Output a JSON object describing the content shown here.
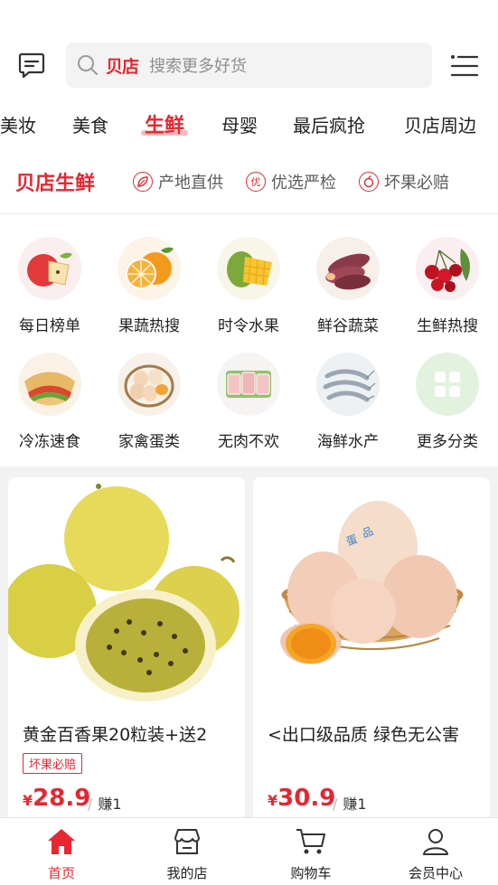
{
  "header": {
    "search_brand": "贝店",
    "search_placeholder": "搜索更多好货"
  },
  "tabs": [
    {
      "label": "美妆"
    },
    {
      "label": "美食"
    },
    {
      "label": "生鲜",
      "active": true
    },
    {
      "label": "母婴"
    },
    {
      "label": "最后疯抢"
    },
    {
      "label": "贝店周边"
    }
  ],
  "section": {
    "title": "贝店生鲜",
    "features": [
      {
        "label": "产地直供",
        "icon": "leaf-icon"
      },
      {
        "label": "优选严检",
        "icon": "quality-icon"
      },
      {
        "label": "坏果必赔",
        "icon": "fruit-icon"
      }
    ]
  },
  "categories": [
    {
      "label": "每日榜单",
      "icon": "apple-icon"
    },
    {
      "label": "果蔬热搜",
      "icon": "orange-icon"
    },
    {
      "label": "时令水果",
      "icon": "mango-icon"
    },
    {
      "label": "鲜谷蔬菜",
      "icon": "sweet-potato-icon"
    },
    {
      "label": "生鲜热搜",
      "icon": "cherry-icon"
    },
    {
      "label": "冷冻速食",
      "icon": "pancake-icon"
    },
    {
      "label": "家禽蛋类",
      "icon": "egg-basket-icon"
    },
    {
      "label": "无肉不欢",
      "icon": "meat-icon"
    },
    {
      "label": "海鲜水产",
      "icon": "shrimp-icon"
    },
    {
      "label": "更多分类",
      "icon": "grid-icon"
    }
  ],
  "products": [
    {
      "name": "黄金百香果20粒装+送2",
      "badge": "坏果必赔",
      "price_symbol": "¥",
      "price": "28.9",
      "earn": "赚1",
      "image": "passion-fruit-image"
    },
    {
      "name": "<出口级品质 绿色无公害",
      "badge": "",
      "price_symbol": "¥",
      "price": "30.9",
      "earn": "赚1",
      "image": "eggs-basket-image"
    }
  ],
  "bottom_nav": [
    {
      "label": "首页",
      "icon": "home-icon",
      "active": true
    },
    {
      "label": "我的店",
      "icon": "shop-icon"
    },
    {
      "label": "购物车",
      "icon": "cart-icon"
    },
    {
      "label": "会员中心",
      "icon": "user-icon"
    }
  ],
  "colors": {
    "accent": "#e8262f",
    "tab_underline": "#f8b9be",
    "background_band": "#f2f2f2"
  }
}
